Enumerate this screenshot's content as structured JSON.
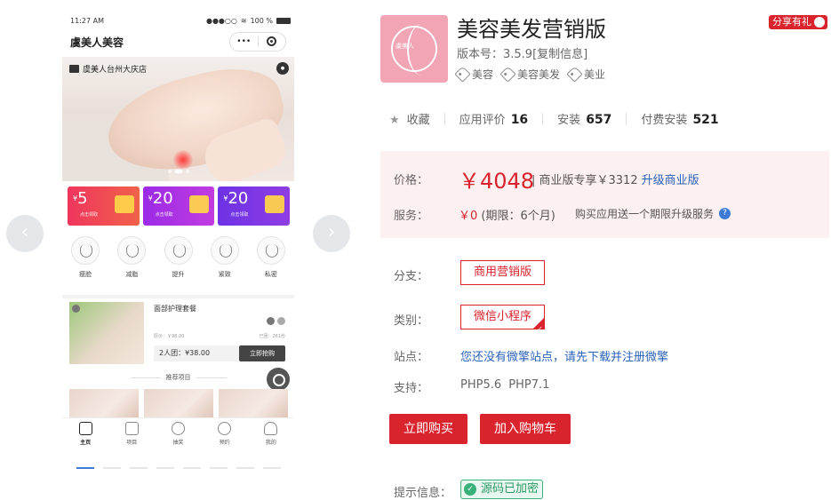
{
  "preview": {
    "status": {
      "time": "11:27 AM",
      "signal": "●●●○○",
      "battery": "100 %"
    },
    "title": "虞美人美容",
    "capsule": {
      "more": "•••"
    },
    "banner": {
      "store": "虞美人台州大庆店"
    },
    "coupons": [
      {
        "value": "5",
        "currency": "¥",
        "sub": "点击领取"
      },
      {
        "value": "20",
        "currency": "¥",
        "sub": "点击领取"
      },
      {
        "value": "20",
        "currency": "¥",
        "sub": "点击领取"
      }
    ],
    "categories": [
      "瘦脸",
      "减脂",
      "提升",
      "紧致",
      "私密"
    ],
    "promo": {
      "title": "面部护理套餐",
      "orig_price": "原价：￥98.00",
      "sold": "已团：261份",
      "group_price": "2人团：¥38.00",
      "buy_label": "立即抢购"
    },
    "recommend_title": "推荐项目",
    "tabs": [
      "主页",
      "项目",
      "抽奖",
      "预约",
      "我的"
    ]
  },
  "nav": {
    "prev": "‹",
    "next": "›"
  },
  "app": {
    "name": "美容美发营销版",
    "version_label": "版本号：3.5.9",
    "copy_info": "[复制信息]",
    "tags": [
      "美容",
      "美容美发",
      "美业"
    ],
    "share_label": "分享有礼",
    "logo_text": "虞美人"
  },
  "stats": {
    "favorite_label": "收藏",
    "rating_label": "应用评价",
    "rating_value": "16",
    "installs_label": "安装",
    "installs_value": "657",
    "paid_label": "付费安装",
    "paid_value": "521"
  },
  "pricing": {
    "price_label": "价格：",
    "price": "￥4048",
    "business_text": "| 商业版专享￥3312",
    "upgrade_link": "升级商业版",
    "service_label": "服务：",
    "service_value": "￥0",
    "service_period": "(期限：6个月)",
    "service_note": "购买应用送一个期限升级服务",
    "help": "?"
  },
  "details": {
    "branch_label": "分支：",
    "branch_value": "商用营销版",
    "type_label": "类别：",
    "type_value": "微信小程序",
    "site_label": "站点：",
    "site_link": "您还没有微擎站点，请先下载并注册微擎",
    "support_label": "支持：",
    "support_value": "PHP5.6  PHP7.1"
  },
  "actions": {
    "buy": "立即购买",
    "cart": "加入购物车"
  },
  "hint": {
    "label": "提示信息：",
    "badge": "源码已加密"
  },
  "colors": {
    "accent": "#d9232d",
    "link": "#2a62b8",
    "logo_bg": "#f2a5b4",
    "price_bg": "#fdf0f0",
    "success": "#3ab07a"
  }
}
